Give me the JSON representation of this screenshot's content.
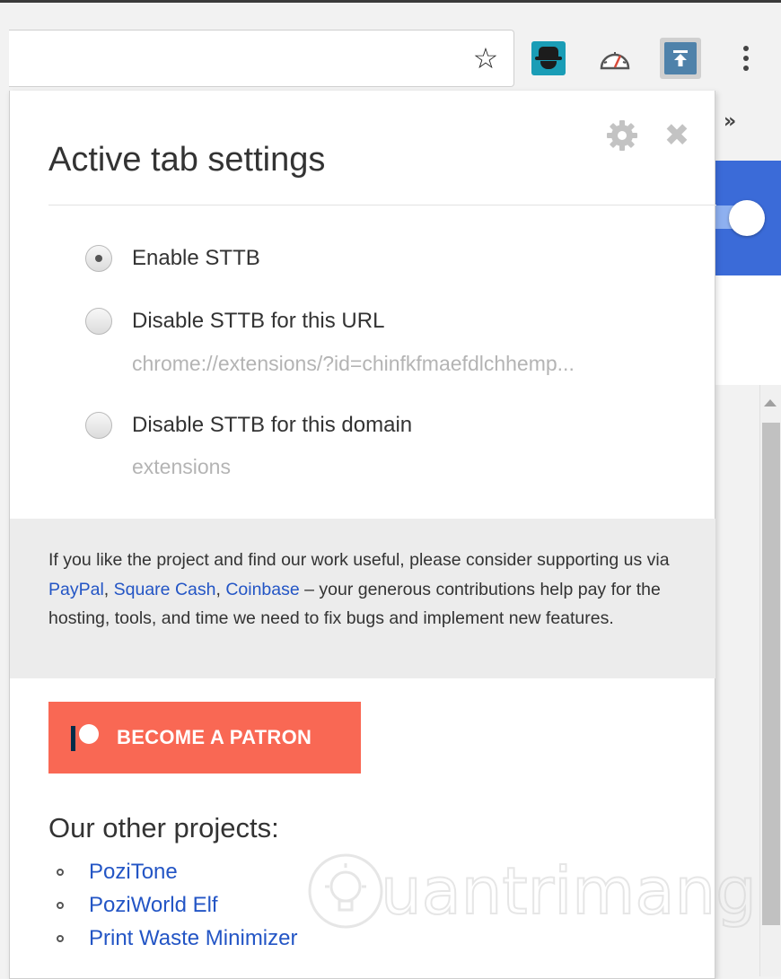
{
  "toolbar": {
    "star_glyph": "☆",
    "extensions": [
      {
        "name": "spy-extension-icon"
      },
      {
        "name": "speedometer-icon"
      },
      {
        "name": "scroll-to-top-icon"
      }
    ]
  },
  "background_page": {
    "overflow_glyph": "»"
  },
  "popup": {
    "title": "Active tab settings",
    "close_glyph": "✖",
    "options": [
      {
        "label": "Enable STTB",
        "checked": true,
        "detail": ""
      },
      {
        "label": "Disable STTB for this URL",
        "checked": false,
        "detail": "chrome://extensions/?id=chinfkfmaefdlchhemp..."
      },
      {
        "label": "Disable STTB for this domain",
        "checked": false,
        "detail": "extensions"
      }
    ],
    "support": {
      "text_before": "If you like the project and find our work useful, please consider supporting us via ",
      "link_paypal": "PayPal",
      "sep1": ", ",
      "link_square": "Square Cash",
      "sep2": ", ",
      "link_coinbase": "Coinbase",
      "text_after": " – your generous contributions help pay for the hosting, tools, and time we need to fix bugs and implement new features."
    },
    "patron_button_label": "BECOME A PATRON",
    "projects_heading": "Our other projects:",
    "projects": [
      "PoziTone",
      "PoziWorld Elf",
      "Print Waste Minimizer"
    ]
  },
  "colors": {
    "patron_orange": "#f96854",
    "link_blue": "#2355c5",
    "background_toggle_blue": "#3b6bd8"
  },
  "watermark": {
    "text": "uantrimang"
  }
}
